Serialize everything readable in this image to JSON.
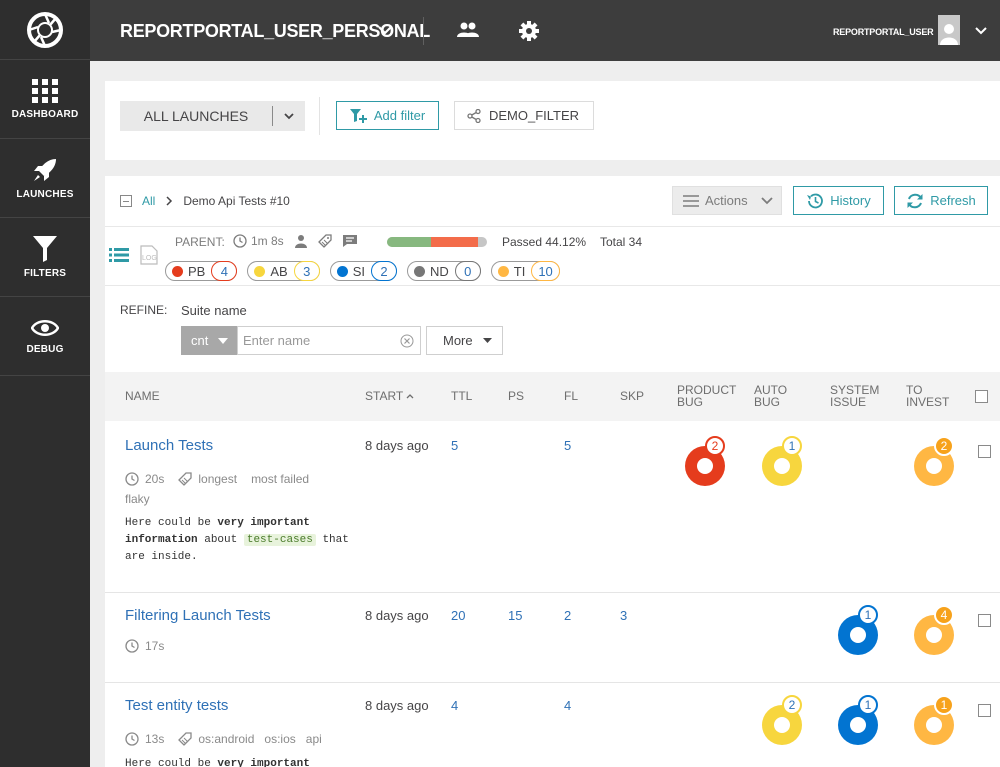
{
  "sidebar": {
    "items": [
      {
        "label": "DASHBOARD",
        "icon": "dashboard-grid-icon"
      },
      {
        "label": "LAUNCHES",
        "icon": "rocket-icon"
      },
      {
        "label": "FILTERS",
        "icon": "funnel-icon"
      },
      {
        "label": "DEBUG",
        "icon": "eye-icon"
      }
    ]
  },
  "header": {
    "project": "REPORTPORTAL_USER_PERSONAL",
    "user": "REPORTPORTAL_USER"
  },
  "filters": {
    "all_launches": "ALL LAUNCHES",
    "add_filter": "Add filter",
    "demo_filter": "DEMO_FILTER"
  },
  "toolbar": {
    "crumb_all": "All",
    "crumb_current": "Demo Api Tests #10",
    "actions": "Actions",
    "history": "History",
    "refresh": "Refresh"
  },
  "parent": {
    "label": "PARENT:",
    "duration": "1m 8s",
    "passed": "Passed 44.12%",
    "total": "Total 34",
    "passed_fraction": 0.4412
  },
  "defects": [
    {
      "code": "PB",
      "count": "4",
      "color": "#e53c1d"
    },
    {
      "code": "AB",
      "count": "3",
      "color": "#f7d63e"
    },
    {
      "code": "SI",
      "count": "2",
      "color": "#0274d1"
    },
    {
      "code": "ND",
      "count": "0",
      "color": "#777777"
    },
    {
      "code": "TI",
      "count": "10",
      "color": "#ffb743"
    }
  ],
  "refine": {
    "label": "REFINE:",
    "suite_label": "Suite name",
    "condition": "cnt",
    "placeholder": "Enter name",
    "more": "More"
  },
  "table": {
    "headers": {
      "name": "NAME",
      "start": "START",
      "ttl": "TTL",
      "ps": "PS",
      "fl": "FL",
      "skp": "SKP",
      "product_bug_1": "PRODUCT",
      "product_bug_2": "BUG",
      "auto_bug_1": "AUTO",
      "auto_bug_2": "BUG",
      "system_issue_1": "SYSTEM",
      "system_issue_2": "ISSUE",
      "to_invest_1": "TO",
      "to_invest_2": "INVEST"
    },
    "rows": [
      {
        "name": "Launch Tests",
        "start": "8 days ago",
        "ttl": "5",
        "ps": "",
        "fl": "5",
        "skp": "",
        "duration": "20s",
        "tags": [
          "longest",
          "most failed"
        ],
        "tags_line2": "flaky",
        "desc_1a": "Here could be ",
        "desc_1b": "very important",
        "desc_2a": "information",
        "desc_2b": " about ",
        "desc_2c": "test-cases",
        "desc_2d": " that",
        "desc_3": "are inside.",
        "pb": "2",
        "ab": "1",
        "si": "",
        "ti": "2"
      },
      {
        "name": "Filtering Launch Tests",
        "start": "8 days ago",
        "ttl": "20",
        "ps": "15",
        "fl": "2",
        "skp": "3",
        "duration": "17s",
        "pb": "",
        "ab": "",
        "si": "1",
        "ti": "4"
      },
      {
        "name": "Test entity tests",
        "start": "8 days ago",
        "ttl": "4",
        "ps": "",
        "fl": "4",
        "skp": "",
        "duration": "13s",
        "tags": [
          "os:android",
          "os:ios",
          "api"
        ],
        "desc_1a": "Here could be ",
        "desc_1b": "very important",
        "pb": "",
        "ab": "2",
        "si": "1",
        "ti": "1"
      }
    ]
  }
}
